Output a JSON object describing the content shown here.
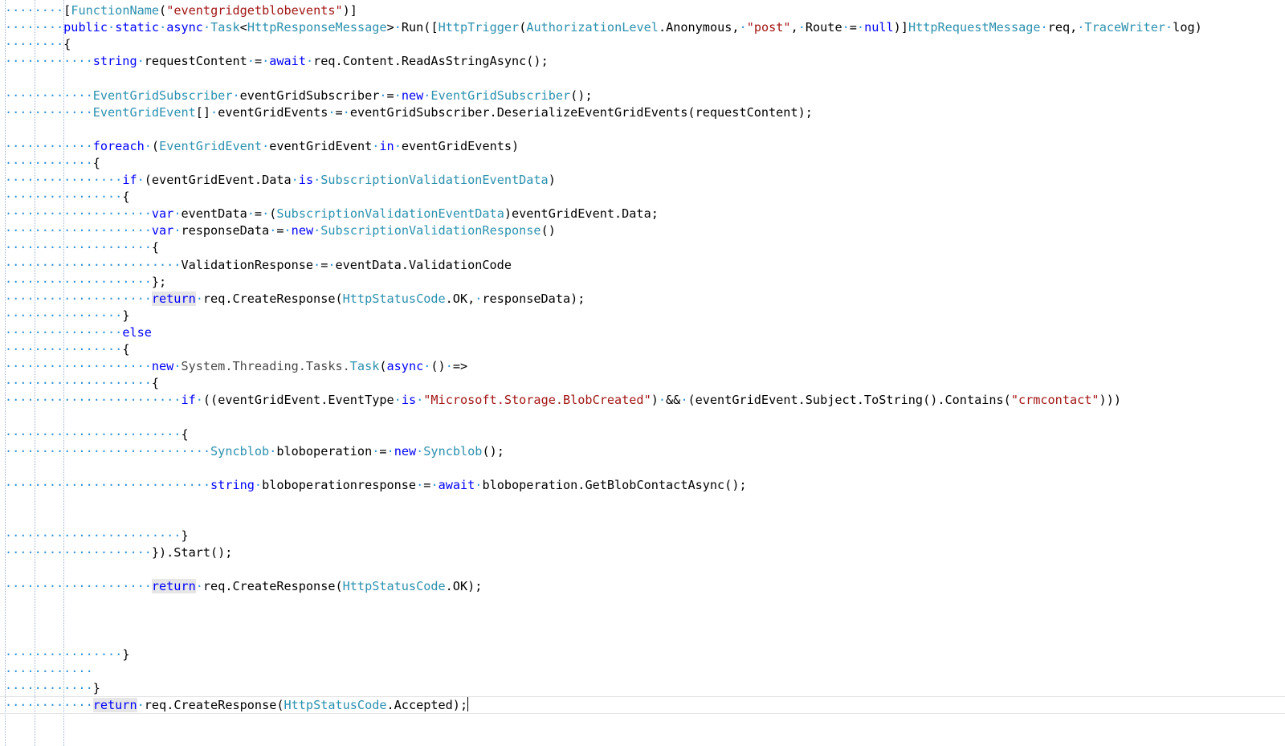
{
  "editor": {
    "caret_line": 42,
    "lines": [
      {
        "id": "l1",
        "ws": "········",
        "parts": [
          {
            "t": "[",
            "c": "pl"
          },
          {
            "t": "FunctionName",
            "c": "ty"
          },
          {
            "t": "(",
            "c": "pl"
          },
          {
            "t": "\"eventgridgetblobevents\"",
            "c": "st"
          },
          {
            "t": ")]",
            "c": "pl"
          }
        ]
      },
      {
        "id": "l2",
        "ws": "········",
        "parts": [
          {
            "t": "public",
            "c": "kw"
          },
          {
            "t": "·",
            "c": "ws"
          },
          {
            "t": "static",
            "c": "kw"
          },
          {
            "t": "·",
            "c": "ws"
          },
          {
            "t": "async",
            "c": "kw"
          },
          {
            "t": "·",
            "c": "ws"
          },
          {
            "t": "Task",
            "c": "ty"
          },
          {
            "t": "<",
            "c": "pl"
          },
          {
            "t": "HttpResponseMessage",
            "c": "ty"
          },
          {
            "t": ">",
            "c": "pl"
          },
          {
            "t": "·",
            "c": "ws"
          },
          {
            "t": "Run([",
            "c": "pl"
          },
          {
            "t": "HttpTrigger",
            "c": "ty"
          },
          {
            "t": "(",
            "c": "pl"
          },
          {
            "t": "AuthorizationLevel",
            "c": "ty"
          },
          {
            "t": ".Anonymous,",
            "c": "pl"
          },
          {
            "t": "·",
            "c": "ws"
          },
          {
            "t": "\"post\"",
            "c": "st"
          },
          {
            "t": ",",
            "c": "pl"
          },
          {
            "t": "·",
            "c": "ws"
          },
          {
            "t": "Route",
            "c": "pl"
          },
          {
            "t": "·",
            "c": "ws"
          },
          {
            "t": "=",
            "c": "pl"
          },
          {
            "t": "·",
            "c": "ws"
          },
          {
            "t": "null",
            "c": "kw"
          },
          {
            "t": ")]",
            "c": "pl"
          },
          {
            "t": "HttpRequestMessage",
            "c": "ty"
          },
          {
            "t": "·",
            "c": "ws"
          },
          {
            "t": "req,",
            "c": "pl"
          },
          {
            "t": "·",
            "c": "ws"
          },
          {
            "t": "TraceWriter",
            "c": "ty"
          },
          {
            "t": "·",
            "c": "ws"
          },
          {
            "t": "log)",
            "c": "pl"
          }
        ]
      },
      {
        "id": "l3",
        "ws": "········",
        "parts": [
          {
            "t": "{",
            "c": "pl"
          }
        ]
      },
      {
        "id": "l4",
        "ws": "············",
        "parts": [
          {
            "t": "string",
            "c": "kw"
          },
          {
            "t": "·",
            "c": "ws"
          },
          {
            "t": "requestContent",
            "c": "pl"
          },
          {
            "t": "·",
            "c": "ws"
          },
          {
            "t": "=",
            "c": "pl"
          },
          {
            "t": "·",
            "c": "ws"
          },
          {
            "t": "await",
            "c": "kw"
          },
          {
            "t": "·",
            "c": "ws"
          },
          {
            "t": "req.Content.ReadAsStringAsync();",
            "c": "pl"
          }
        ]
      },
      {
        "id": "l5",
        "ws": "",
        "parts": []
      },
      {
        "id": "l6",
        "ws": "············",
        "parts": [
          {
            "t": "EventGridSubscriber",
            "c": "ty"
          },
          {
            "t": "·",
            "c": "ws"
          },
          {
            "t": "eventGridSubscriber",
            "c": "pl"
          },
          {
            "t": "·",
            "c": "ws"
          },
          {
            "t": "=",
            "c": "pl"
          },
          {
            "t": "·",
            "c": "ws"
          },
          {
            "t": "new",
            "c": "kw"
          },
          {
            "t": "·",
            "c": "ws"
          },
          {
            "t": "EventGridSubscriber",
            "c": "ty"
          },
          {
            "t": "();",
            "c": "pl"
          }
        ]
      },
      {
        "id": "l7",
        "ws": "············",
        "parts": [
          {
            "t": "EventGridEvent",
            "c": "ty"
          },
          {
            "t": "[]",
            "c": "pl"
          },
          {
            "t": "·",
            "c": "ws"
          },
          {
            "t": "eventGridEvents",
            "c": "pl"
          },
          {
            "t": "·",
            "c": "ws"
          },
          {
            "t": "=",
            "c": "pl"
          },
          {
            "t": "·",
            "c": "ws"
          },
          {
            "t": "eventGridSubscriber.DeserializeEventGridEvents(requestContent);",
            "c": "pl"
          }
        ]
      },
      {
        "id": "l8",
        "ws": "",
        "parts": []
      },
      {
        "id": "l9",
        "ws": "············",
        "parts": [
          {
            "t": "foreach",
            "c": "kw"
          },
          {
            "t": "·",
            "c": "ws"
          },
          {
            "t": "(",
            "c": "pl"
          },
          {
            "t": "EventGridEvent",
            "c": "ty"
          },
          {
            "t": "·",
            "c": "ws"
          },
          {
            "t": "eventGridEvent",
            "c": "pl"
          },
          {
            "t": "·",
            "c": "ws"
          },
          {
            "t": "in",
            "c": "kw"
          },
          {
            "t": "·",
            "c": "ws"
          },
          {
            "t": "eventGridEvents)",
            "c": "pl"
          }
        ]
      },
      {
        "id": "l10",
        "ws": "············",
        "parts": [
          {
            "t": "{",
            "c": "pl"
          }
        ]
      },
      {
        "id": "l11",
        "ws": "················",
        "parts": [
          {
            "t": "if",
            "c": "kw"
          },
          {
            "t": "·",
            "c": "ws"
          },
          {
            "t": "(eventGridEvent.Data",
            "c": "pl"
          },
          {
            "t": "·",
            "c": "ws"
          },
          {
            "t": "is",
            "c": "kw"
          },
          {
            "t": "·",
            "c": "ws"
          },
          {
            "t": "SubscriptionValidationEventData",
            "c": "ty"
          },
          {
            "t": ")",
            "c": "pl"
          }
        ]
      },
      {
        "id": "l12",
        "ws": "················",
        "parts": [
          {
            "t": "{",
            "c": "pl"
          }
        ]
      },
      {
        "id": "l13",
        "ws": "····················",
        "parts": [
          {
            "t": "var",
            "c": "kw"
          },
          {
            "t": "·",
            "c": "ws"
          },
          {
            "t": "eventData",
            "c": "pl"
          },
          {
            "t": "·",
            "c": "ws"
          },
          {
            "t": "=",
            "c": "pl"
          },
          {
            "t": "·",
            "c": "ws"
          },
          {
            "t": "(",
            "c": "pl"
          },
          {
            "t": "SubscriptionValidationEventData",
            "c": "ty"
          },
          {
            "t": ")eventGridEvent.Data;",
            "c": "pl"
          }
        ]
      },
      {
        "id": "l14",
        "ws": "····················",
        "parts": [
          {
            "t": "var",
            "c": "kw"
          },
          {
            "t": "·",
            "c": "ws"
          },
          {
            "t": "responseData",
            "c": "pl"
          },
          {
            "t": "·",
            "c": "ws"
          },
          {
            "t": "=",
            "c": "pl"
          },
          {
            "t": "·",
            "c": "ws"
          },
          {
            "t": "new",
            "c": "kw"
          },
          {
            "t": "·",
            "c": "ws"
          },
          {
            "t": "SubscriptionValidationResponse",
            "c": "ty"
          },
          {
            "t": "()",
            "c": "pl"
          }
        ]
      },
      {
        "id": "l15",
        "ws": "····················",
        "parts": [
          {
            "t": "{",
            "c": "pl"
          }
        ]
      },
      {
        "id": "l16",
        "ws": "························",
        "parts": [
          {
            "t": "ValidationResponse",
            "c": "pl"
          },
          {
            "t": "·",
            "c": "ws"
          },
          {
            "t": "=",
            "c": "pl"
          },
          {
            "t": "·",
            "c": "ws"
          },
          {
            "t": "eventData.ValidationCode",
            "c": "pl"
          }
        ]
      },
      {
        "id": "l17",
        "ws": "····················",
        "parts": [
          {
            "t": "};",
            "c": "pl"
          }
        ]
      },
      {
        "id": "l18",
        "ws": "····················",
        "parts": [
          {
            "t": "return",
            "c": "kw",
            "h": true
          },
          {
            "t": "·",
            "c": "ws"
          },
          {
            "t": "req.CreateResponse(",
            "c": "pl"
          },
          {
            "t": "HttpStatusCode",
            "c": "ty"
          },
          {
            "t": ".OK,",
            "c": "pl"
          },
          {
            "t": "·",
            "c": "ws"
          },
          {
            "t": "responseData);",
            "c": "pl"
          }
        ]
      },
      {
        "id": "l19",
        "ws": "················",
        "parts": [
          {
            "t": "}",
            "c": "pl"
          }
        ]
      },
      {
        "id": "l20",
        "ws": "················",
        "parts": [
          {
            "t": "else",
            "c": "kw"
          }
        ]
      },
      {
        "id": "l21",
        "ws": "················",
        "parts": [
          {
            "t": "{",
            "c": "pl"
          }
        ]
      },
      {
        "id": "l22",
        "ws": "····················",
        "parts": [
          {
            "t": "new",
            "c": "kw"
          },
          {
            "t": "·",
            "c": "ws"
          },
          {
            "t": "System.Threading.Tasks.",
            "c": "gr"
          },
          {
            "t": "Task",
            "c": "ty"
          },
          {
            "t": "(",
            "c": "pl"
          },
          {
            "t": "async",
            "c": "kw"
          },
          {
            "t": "·",
            "c": "ws"
          },
          {
            "t": "()",
            "c": "pl"
          },
          {
            "t": "·",
            "c": "ws"
          },
          {
            "t": "=>",
            "c": "pl"
          }
        ]
      },
      {
        "id": "l23",
        "ws": "····················",
        "parts": [
          {
            "t": "{",
            "c": "pl"
          }
        ]
      },
      {
        "id": "l24",
        "ws": "························",
        "parts": [
          {
            "t": "if",
            "c": "kw"
          },
          {
            "t": "·",
            "c": "ws"
          },
          {
            "t": "((eventGridEvent.EventType",
            "c": "pl"
          },
          {
            "t": "·",
            "c": "ws"
          },
          {
            "t": "is",
            "c": "kw"
          },
          {
            "t": "·",
            "c": "ws"
          },
          {
            "t": "\"Microsoft.Storage.BlobCreated\"",
            "c": "st"
          },
          {
            "t": ")",
            "c": "pl"
          },
          {
            "t": "·",
            "c": "ws"
          },
          {
            "t": "&&",
            "c": "pl"
          },
          {
            "t": "·",
            "c": "ws"
          },
          {
            "t": "(eventGridEvent.Subject.ToString().Contains(",
            "c": "pl"
          },
          {
            "t": "\"crmcontact\"",
            "c": "st"
          },
          {
            "t": ")))",
            "c": "pl"
          }
        ]
      },
      {
        "id": "l25",
        "ws": "",
        "parts": []
      },
      {
        "id": "l26",
        "ws": "························",
        "parts": [
          {
            "t": "{",
            "c": "pl"
          }
        ]
      },
      {
        "id": "l27",
        "ws": "····························",
        "parts": [
          {
            "t": "Syncblob",
            "c": "ty"
          },
          {
            "t": "·",
            "c": "ws"
          },
          {
            "t": "bloboperation",
            "c": "pl"
          },
          {
            "t": "·",
            "c": "ws"
          },
          {
            "t": "=",
            "c": "pl"
          },
          {
            "t": "·",
            "c": "ws"
          },
          {
            "t": "new",
            "c": "kw"
          },
          {
            "t": "·",
            "c": "ws"
          },
          {
            "t": "Syncblob",
            "c": "ty"
          },
          {
            "t": "();",
            "c": "pl"
          }
        ]
      },
      {
        "id": "l28",
        "ws": "",
        "parts": []
      },
      {
        "id": "l29",
        "ws": "····························",
        "parts": [
          {
            "t": "string",
            "c": "kw"
          },
          {
            "t": "·",
            "c": "ws"
          },
          {
            "t": "bloboperationresponse",
            "c": "pl"
          },
          {
            "t": "·",
            "c": "ws"
          },
          {
            "t": "=",
            "c": "pl"
          },
          {
            "t": "·",
            "c": "ws"
          },
          {
            "t": "await",
            "c": "kw"
          },
          {
            "t": "·",
            "c": "ws"
          },
          {
            "t": "bloboperation.GetBlobContactAsync();",
            "c": "pl"
          }
        ]
      },
      {
        "id": "l30",
        "ws": "",
        "parts": []
      },
      {
        "id": "l31",
        "ws": "",
        "parts": []
      },
      {
        "id": "l32",
        "ws": "························",
        "parts": [
          {
            "t": "}",
            "c": "pl"
          }
        ]
      },
      {
        "id": "l33",
        "ws": "····················",
        "parts": [
          {
            "t": "}).Start();",
            "c": "pl"
          }
        ]
      },
      {
        "id": "l34",
        "ws": "",
        "parts": []
      },
      {
        "id": "l35",
        "ws": "····················",
        "parts": [
          {
            "t": "return",
            "c": "kw",
            "h": true
          },
          {
            "t": "·",
            "c": "ws"
          },
          {
            "t": "req.CreateResponse(",
            "c": "pl"
          },
          {
            "t": "HttpStatusCode",
            "c": "ty"
          },
          {
            "t": ".OK);",
            "c": "pl"
          }
        ]
      },
      {
        "id": "l36",
        "ws": "",
        "parts": []
      },
      {
        "id": "l37",
        "ws": "",
        "parts": []
      },
      {
        "id": "l38",
        "ws": "",
        "parts": []
      },
      {
        "id": "l39",
        "ws": "················",
        "parts": [
          {
            "t": "}",
            "c": "pl"
          }
        ]
      },
      {
        "id": "l40",
        "ws": "············",
        "parts": []
      },
      {
        "id": "l41",
        "ws": "············",
        "parts": [
          {
            "t": "}",
            "c": "pl"
          }
        ]
      },
      {
        "id": "l42",
        "ws": "············",
        "parts": [
          {
            "t": "return",
            "c": "kw",
            "h": true
          },
          {
            "t": "·",
            "c": "ws"
          },
          {
            "t": "req.CreateResponse(",
            "c": "pl"
          },
          {
            "t": "HttpStatusCode",
            "c": "ty"
          },
          {
            "t": ".Accepted);",
            "c": "pl"
          }
        ]
      }
    ]
  }
}
